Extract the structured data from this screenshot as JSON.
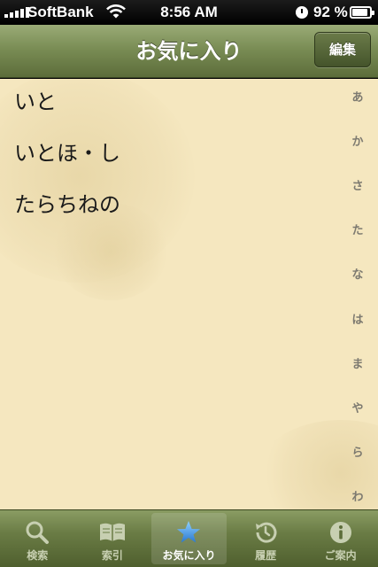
{
  "status_bar": {
    "carrier": "SoftBank",
    "time": "8:56 AM",
    "battery_percent": "92 %",
    "battery_level": 0.92
  },
  "nav": {
    "title": "お気に入り",
    "edit_label": "編集"
  },
  "favorites": [
    "いと",
    "いとほ・し",
    "たらちねの"
  ],
  "index": [
    "あ",
    "か",
    "さ",
    "た",
    "な",
    "は",
    "ま",
    "や",
    "ら",
    "わ"
  ],
  "tabs": [
    {
      "label": "検索",
      "icon": "search-icon"
    },
    {
      "label": "索引",
      "icon": "book-icon"
    },
    {
      "label": "お気に入り",
      "icon": "star-icon",
      "active": true
    },
    {
      "label": "履歴",
      "icon": "history-icon"
    },
    {
      "label": "ご案内",
      "icon": "info-icon"
    }
  ],
  "colors": {
    "navbar": "#7a8d55",
    "background": "#f5e7bf",
    "star_active": "#3f8fe0"
  }
}
